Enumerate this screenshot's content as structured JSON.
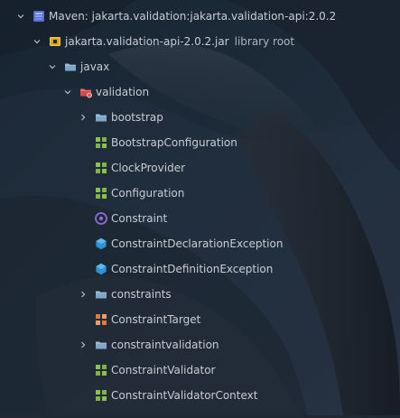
{
  "tree": {
    "rows": [
      {
        "label": "Maven: jakarta.validation:jakarta.validation-api:2.0.2",
        "icon": "library-icon",
        "expanded": true
      },
      {
        "label": "jakarta.validation-api-2.0.2.jar",
        "suffix": "library root",
        "icon": "jar-icon",
        "expanded": true
      },
      {
        "label": "javax",
        "icon": "package-folder-icon",
        "expanded": true
      },
      {
        "label": "validation",
        "icon": "package-folder-red-icon",
        "expanded": true
      },
      {
        "label": "bootstrap",
        "icon": "package-folder-icon",
        "expanded": false
      },
      {
        "label": "BootstrapConfiguration",
        "icon": "interface-icon"
      },
      {
        "label": "ClockProvider",
        "icon": "interface-icon"
      },
      {
        "label": "Configuration",
        "icon": "interface-icon"
      },
      {
        "label": "Constraint",
        "icon": "annotation-icon"
      },
      {
        "label": "ConstraintDeclarationException",
        "icon": "exception-class-icon"
      },
      {
        "label": "ConstraintDefinitionException",
        "icon": "exception-class-icon"
      },
      {
        "label": "constraints",
        "icon": "package-folder-icon",
        "expanded": false
      },
      {
        "label": "ConstraintTarget",
        "icon": "enum-icon"
      },
      {
        "label": "constraintvalidation",
        "icon": "package-folder-icon",
        "expanded": false
      },
      {
        "label": "ConstraintValidator",
        "icon": "interface-icon"
      },
      {
        "label": "ConstraintValidatorContext",
        "icon": "interface-icon"
      }
    ]
  },
  "colors": {
    "text": "#c9cdd3",
    "muted": "#aeb4bb",
    "folder": "#7fa7c7",
    "library": "#5b6fd1",
    "interface": "#8bc34a",
    "annotation": "#8f6ad8",
    "exception": "#2f92d6",
    "enum": "#e07a3b",
    "jarYellow": "#f2c94c",
    "redBadge": "#e35b5b"
  }
}
